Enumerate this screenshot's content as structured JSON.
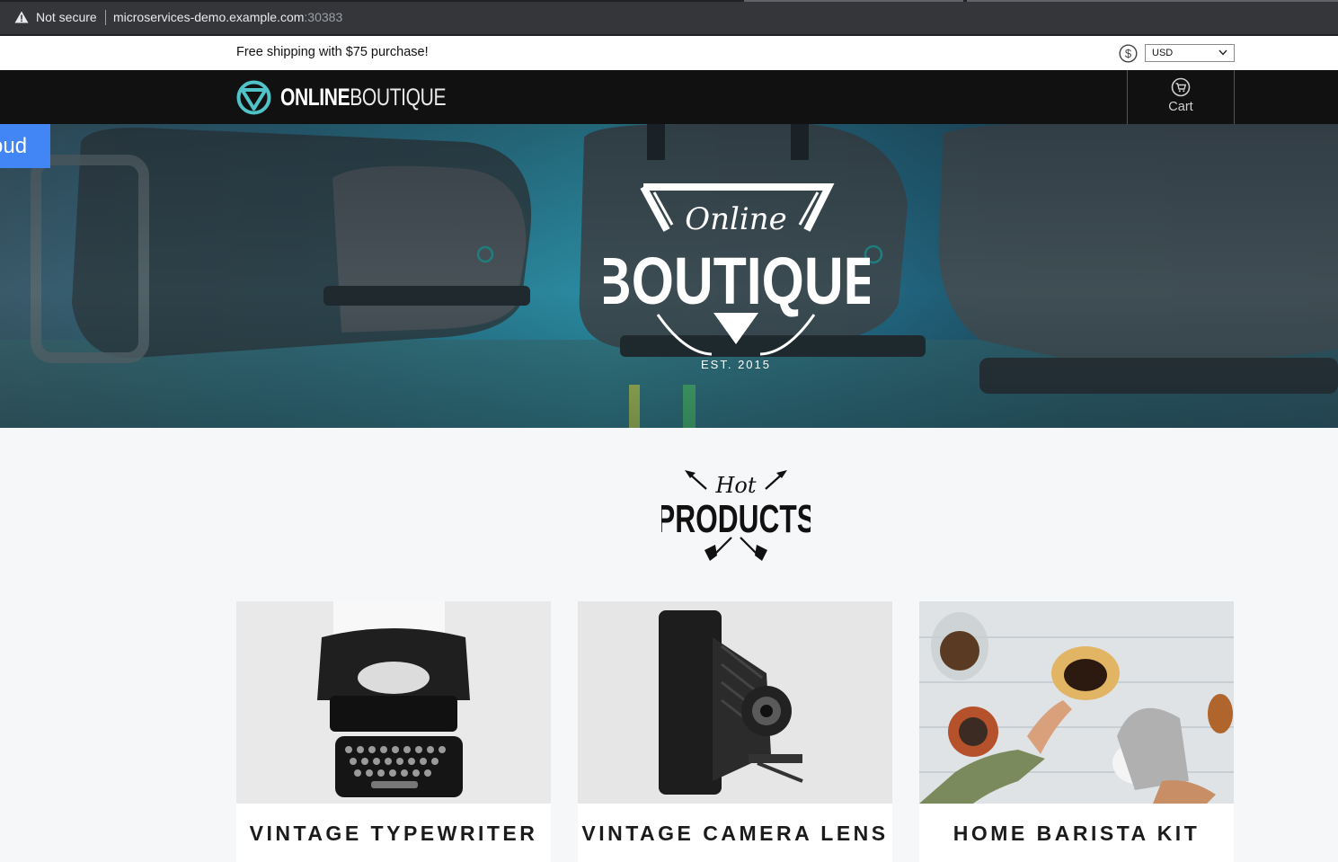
{
  "browser": {
    "security_label": "Not secure",
    "url_host": "microservices-demo.example.com",
    "url_port": ":30383",
    "icons": {
      "security": "warning-triangle-icon"
    }
  },
  "shipping_bar": {
    "text": "Free shipping with $75 purchase!",
    "currency_icon": "dollar-circle-icon",
    "currency_selected": "USD"
  },
  "header": {
    "logo_bold": "ONLINE",
    "logo_light": "BOUTIQUE",
    "cart_label": "Cart",
    "icons": {
      "logo": "boutique-logo-icon",
      "cart": "cart-icon"
    }
  },
  "hero": {
    "side_tab_text": "oud",
    "logo_script": "Online",
    "logo_main": "BOUTIQUE",
    "logo_est": "EST. 2015",
    "colors": {
      "side_tab": "#4285f4",
      "teal": "#4fc3c7"
    }
  },
  "hot_products": {
    "script": "Hot",
    "main": "PRODUCTS"
  },
  "products": [
    {
      "name": "VINTAGE TYPEWRITER",
      "image": "typewriter-image"
    },
    {
      "name": "VINTAGE CAMERA LENS",
      "image": "camera-image"
    },
    {
      "name": "HOME BARISTA KIT",
      "image": "barista-kit-image"
    }
  ]
}
